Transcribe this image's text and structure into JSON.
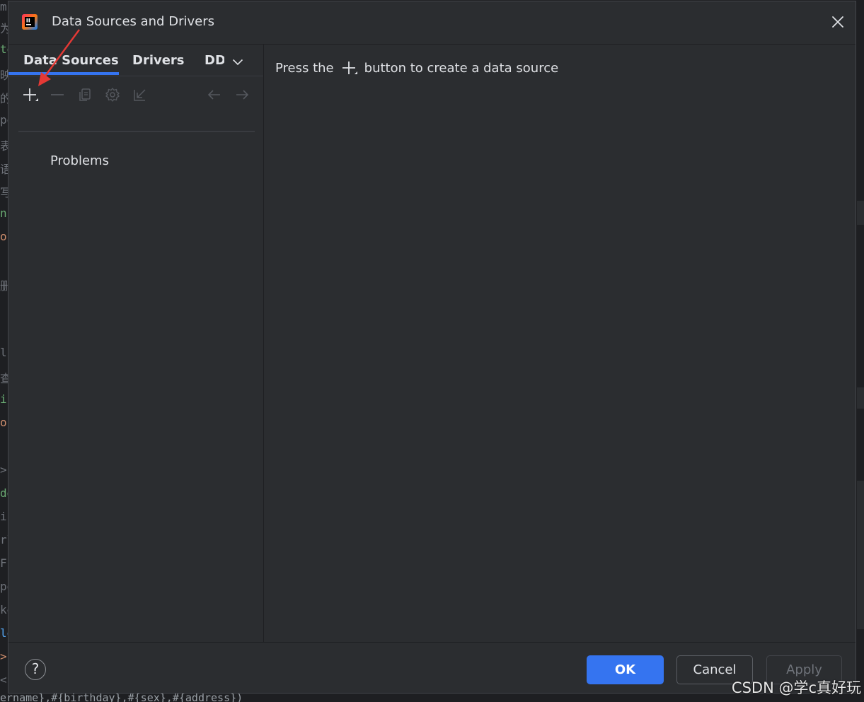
{
  "dialog": {
    "title": "Data Sources and Drivers",
    "logo_icon": "intellij-idea-icon",
    "close_icon": "close-icon"
  },
  "tabs": [
    {
      "label": "Data Sources",
      "active": true
    },
    {
      "label": "Drivers",
      "active": false
    },
    {
      "label": "DD",
      "active": false
    }
  ],
  "tabs_overflow_icon": "chevron-down-icon",
  "toolbar": {
    "buttons": [
      {
        "icon": "add-icon",
        "enabled": true
      },
      {
        "icon": "remove-icon",
        "enabled": false
      },
      {
        "icon": "copy-icon",
        "enabled": false
      },
      {
        "icon": "settings-icon",
        "enabled": false
      },
      {
        "icon": "import-icon",
        "enabled": false
      },
      {
        "icon": "arrow-left-icon",
        "enabled": false
      },
      {
        "icon": "arrow-right-icon",
        "enabled": false
      }
    ]
  },
  "tree": {
    "problems_label": "Problems"
  },
  "main": {
    "hint_prefix": "Press the",
    "hint_suffix": "button to create a data source"
  },
  "footer": {
    "help_label": "?",
    "ok_label": "OK",
    "cancel_label": "Cancel",
    "apply_label": "Apply",
    "apply_enabled": false
  },
  "background": {
    "editor_left_glyphs": [
      "m",
      "为",
      "te",
      "映",
      "的",
      "pe",
      "表",
      "语",
      "写",
      "nc",
      "or",
      "",
      "删",
      "",
      "l",
      "查",
      "in",
      "or",
      "",
      ">",
      "dd",
      "",
      "i",
      "rl",
      "F",
      "pe",
      "ke",
      "lo",
      ">",
      "<"
    ],
    "editor_bottom_text": "ername},#{birthday},#{sex},#{address})"
  },
  "watermark": "CSDN @学c真好玩",
  "colors": {
    "dialog_bg": "#2b2d30",
    "accent": "#3574f0",
    "text": "#dfe1e5",
    "disabled": "#6f737a",
    "annotation_arrow": "#e53935"
  }
}
